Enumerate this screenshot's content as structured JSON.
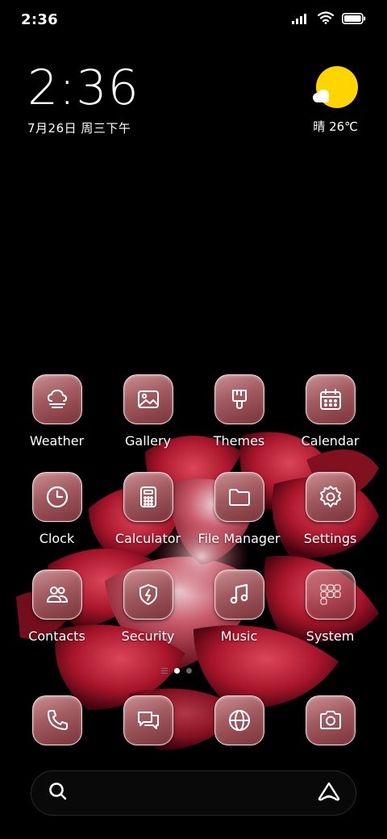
{
  "status_bar": {
    "time": "2:36",
    "icons": [
      "signal-icon",
      "wifi-icon",
      "battery-icon"
    ]
  },
  "clock_widget": {
    "time": "2:36",
    "date": "7月26日 周三下午"
  },
  "weather_widget": {
    "condition_icon": "sunny-partly-cloudy-icon",
    "text": "晴 26℃"
  },
  "apps": [
    {
      "label": "Weather",
      "icon": "weather-icon"
    },
    {
      "label": "Gallery",
      "icon": "gallery-icon"
    },
    {
      "label": "Themes",
      "icon": "themes-icon"
    },
    {
      "label": "Calendar",
      "icon": "calendar-icon"
    },
    {
      "label": "Clock",
      "icon": "clock-icon"
    },
    {
      "label": "Calculator",
      "icon": "calculator-icon"
    },
    {
      "label": "File Manager",
      "icon": "folder-icon"
    },
    {
      "label": "Settings",
      "icon": "gear-icon"
    },
    {
      "label": "Contacts",
      "icon": "contacts-icon"
    },
    {
      "label": "Security",
      "icon": "shield-icon"
    },
    {
      "label": "Music",
      "icon": "music-note-icon"
    },
    {
      "label": "System",
      "icon": "folder-grid-icon"
    }
  ],
  "page_indicator": {
    "pages": 2,
    "current": 1
  },
  "dock": [
    {
      "icon": "phone-icon"
    },
    {
      "icon": "messages-icon"
    },
    {
      "icon": "browser-icon"
    },
    {
      "icon": "camera-icon"
    }
  ],
  "search_bar": {
    "left_icon": "search-icon",
    "right_icon": "assistant-icon"
  },
  "colors": {
    "accent_sun": "#FFD500",
    "icon_tint": "#a15a5f",
    "background": "#000000"
  }
}
